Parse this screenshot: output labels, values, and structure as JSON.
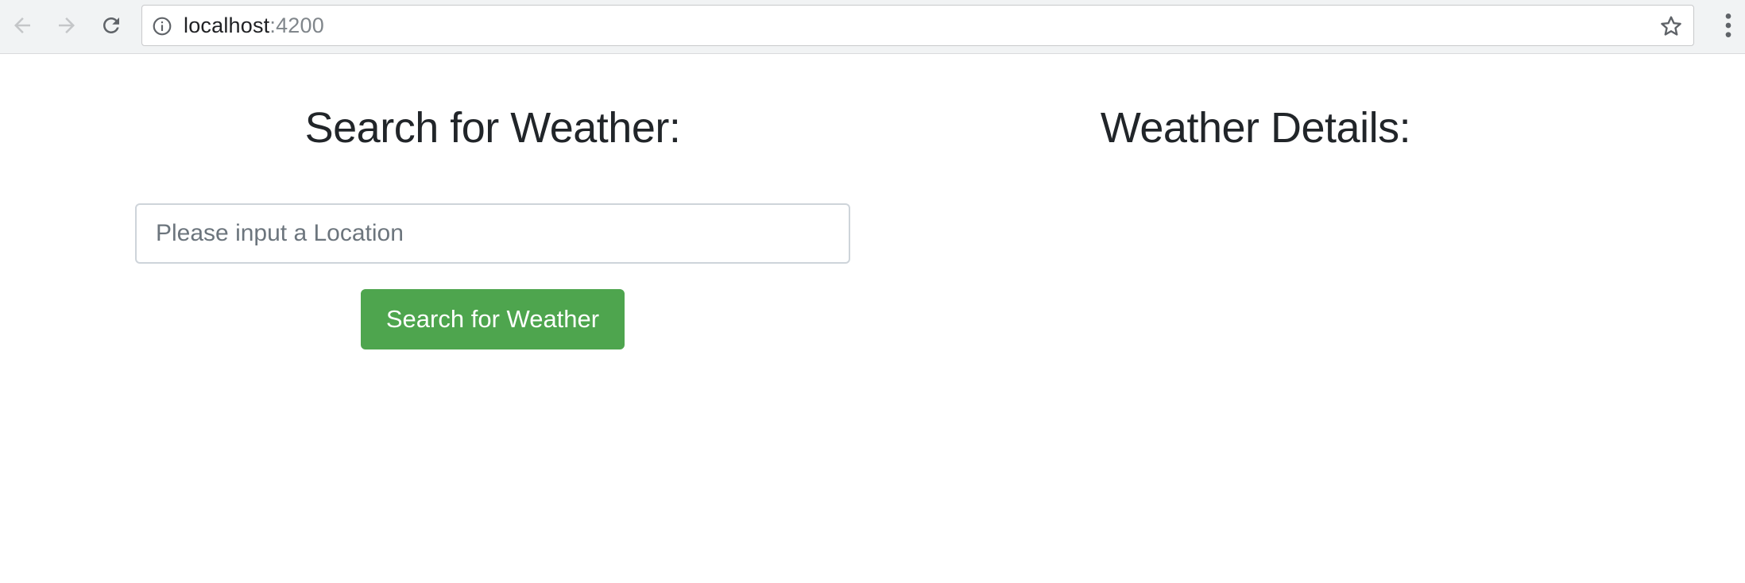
{
  "browser": {
    "url_host": "localhost",
    "url_port": ":4200",
    "icons": {
      "back": "arrow-left-icon",
      "forward": "arrow-right-icon",
      "reload": "reload-icon",
      "info": "info-icon",
      "bookmark": "star-icon",
      "menu": "three-dot-menu-icon"
    }
  },
  "search_panel": {
    "heading": "Search for Weather:",
    "input_placeholder": "Please input a Location",
    "input_value": "",
    "button_label": "Search for Weather"
  },
  "details_panel": {
    "heading": "Weather Details:"
  },
  "colors": {
    "button_green": "#4ea54e",
    "heading_text": "#212529",
    "toolbar_bg": "#f1f3f4"
  }
}
